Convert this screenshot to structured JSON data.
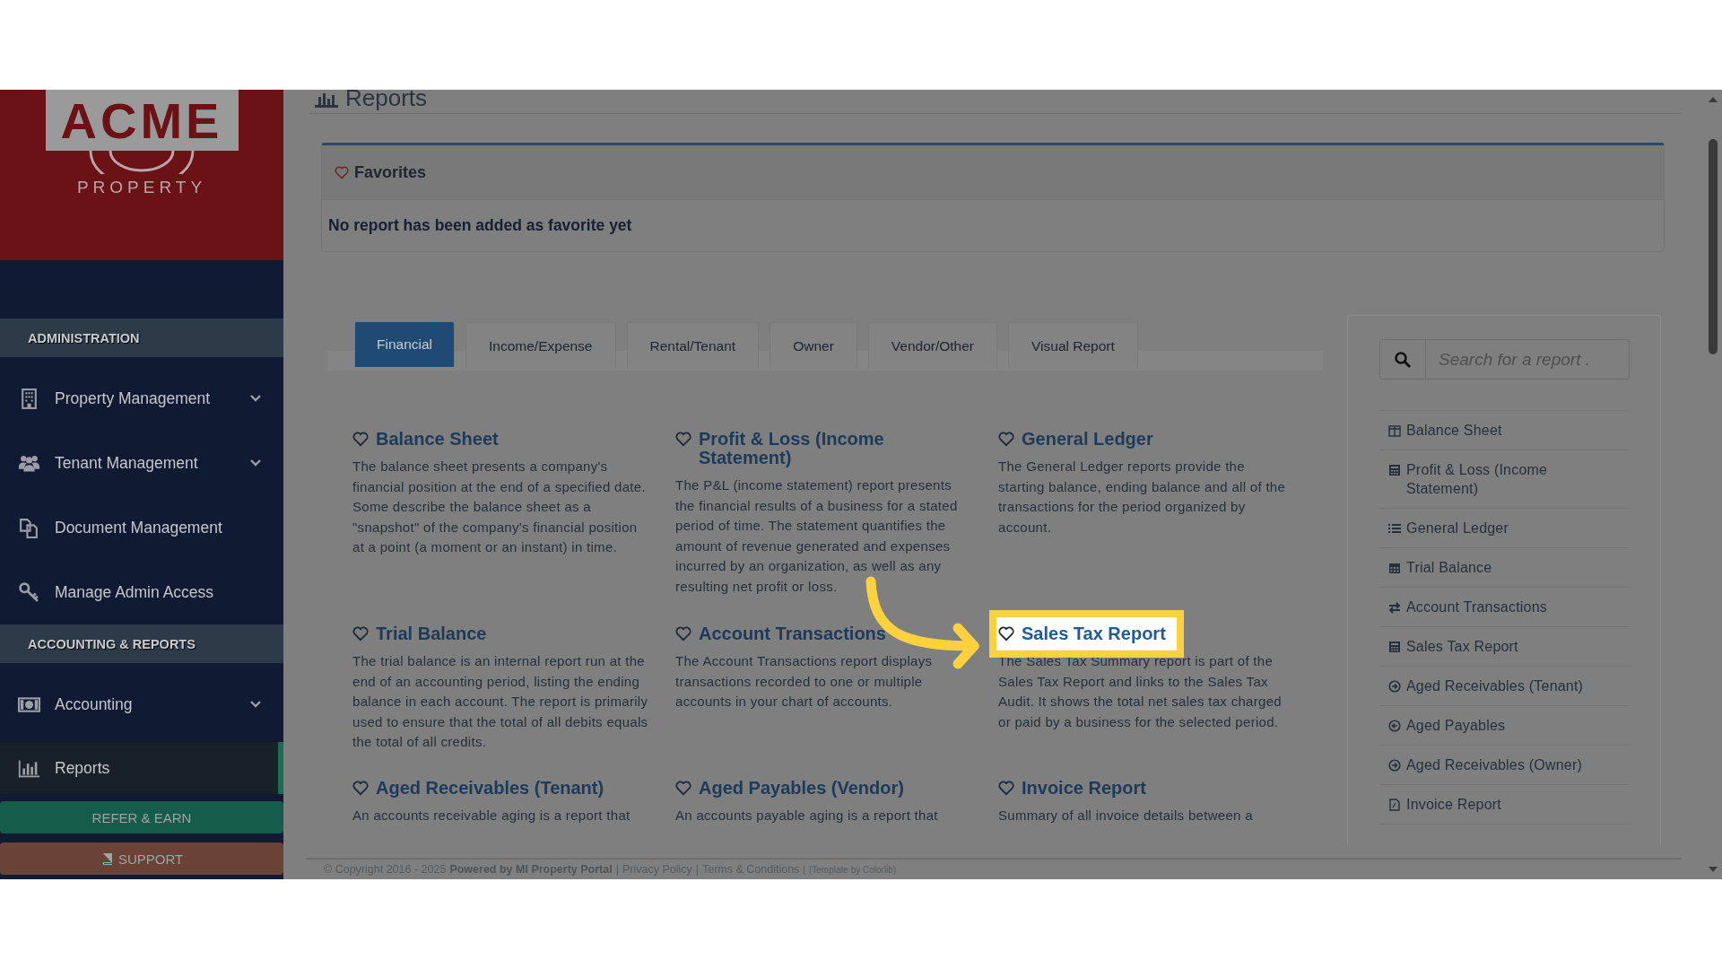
{
  "logo": {
    "name": "ACME",
    "tagline": "PROPERTY"
  },
  "sidebar": {
    "sections": [
      {
        "title": "ADMINISTRATION",
        "items": [
          {
            "label": "Property Management",
            "expandable": true,
            "selected": false
          },
          {
            "label": "Tenant Management",
            "expandable": true,
            "selected": false
          },
          {
            "label": "Document Management",
            "expandable": false,
            "selected": false
          },
          {
            "label": "Manage Admin Access",
            "expandable": false,
            "selected": false
          }
        ]
      },
      {
        "title": "ACCOUNTING & REPORTS",
        "items": [
          {
            "label": "Accounting",
            "expandable": true,
            "selected": false
          },
          {
            "label": "Reports",
            "expandable": false,
            "selected": true
          }
        ]
      }
    ],
    "buttons": [
      {
        "label": "REFER & EARN",
        "kind": "refer"
      },
      {
        "label": "SUPPORT",
        "kind": "support"
      }
    ]
  },
  "page": {
    "title": "Reports"
  },
  "favorites": {
    "title": "Favorites",
    "message": "No report has been added as favorite yet"
  },
  "tabs": [
    {
      "label": "Financial",
      "selected": true
    },
    {
      "label": "Income/Expense",
      "selected": false
    },
    {
      "label": "Rental/Tenant",
      "selected": false
    },
    {
      "label": "Owner",
      "selected": false
    },
    {
      "label": "Vendor/Other",
      "selected": false
    },
    {
      "label": "Visual Report",
      "selected": false
    }
  ],
  "reports": [
    {
      "title": "Balance Sheet",
      "description": "The balance sheet presents a company's financial position at the end of a specified date. Some describe the balance sheet as a \"snapshot\" of the company's financial position at a point (a moment or an instant) in time.",
      "highlighted": false
    },
    {
      "title": "Profit & Loss (Income Statement)",
      "description": "The P&L (income statement) report presents the financial results of a business for a stated period of time. The statement quantifies the amount of revenue generated and expenses incurred by an organization, as well as any resulting net profit or loss.",
      "highlighted": false
    },
    {
      "title": "General Ledger",
      "description": "The General Ledger reports provide the starting balance, ending balance and all of the transactions for the period organized by account.",
      "highlighted": false
    },
    {
      "title": "Trial Balance",
      "description": "The trial balance is an internal report run at the end of an accounting period, listing the ending balance in each account. The report is primarily used to ensure that the total of all debits equals the total of all credits.",
      "highlighted": false
    },
    {
      "title": "Account Transactions",
      "description": "The Account Transactions report displays transactions recorded to one or multiple accounts in your chart of accounts.",
      "highlighted": false
    },
    {
      "title": "Sales Tax Report",
      "description": "The Sales Tax Summary report is part of the Sales Tax Report and links to the Sales Tax Audit. It shows the total net sales tax charged or paid by a business for the selected period.",
      "highlighted": true
    },
    {
      "title": "Aged Receivables (Tenant)",
      "description": "An accounts receivable aging is a report that",
      "highlighted": false
    },
    {
      "title": "Aged Payables (Vendor)",
      "description": "An accounts payable aging is a report that",
      "highlighted": false
    },
    {
      "title": "Invoice Report",
      "description": "Summary of all invoice details between a",
      "highlighted": false
    }
  ],
  "search": {
    "placeholder": "Search for a report ."
  },
  "quick_links": [
    "Balance Sheet",
    "Profit & Loss (Income Statement)",
    "General Ledger",
    "Trial Balance",
    "Account Transactions",
    "Sales Tax Report",
    "Aged Receivables (Tenant)",
    "Aged Payables",
    "Aged Receivables (Owner)",
    "Invoice Report"
  ],
  "footer": {
    "copyright": "© Copyright 2016 - 2025",
    "powered": "Powered by MI Property Portal",
    "separator": "|",
    "links": [
      "Privacy Policy",
      "Terms & Conditions"
    ],
    "credit": "(Template by Colorlib)"
  }
}
